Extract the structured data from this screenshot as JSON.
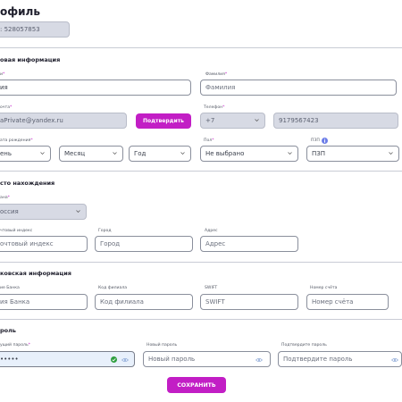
{
  "page": {
    "title": "офиль",
    "id_field": ": 528057853"
  },
  "basic": {
    "heading": "овая информация",
    "first_name": {
      "label": "и",
      "value": "ия"
    },
    "last_name": {
      "label": "Фамилия",
      "placeholder": "Фамилия"
    },
    "email": {
      "label": "очта",
      "value": "aPrivate@yandex.ru"
    },
    "confirm_button": "Подтвердить",
    "phone": {
      "label": "Телефон",
      "code": "+7",
      "number": "9179567423"
    },
    "birth": {
      "label": "ата рождения",
      "day": "ень",
      "month": "Месяц",
      "year": "Год"
    },
    "gender": {
      "label": "Пол",
      "value": "Не выбрано"
    },
    "pzp": {
      "label": "ПЗП",
      "value": "ПЗП"
    }
  },
  "location": {
    "heading": "сто нахождения",
    "country": {
      "label": "ана",
      "value": "оссия"
    },
    "postal": {
      "label": "чтовый индекс",
      "placeholder": "очтовый индекс"
    },
    "city": {
      "label": "Город",
      "placeholder": "Город"
    },
    "address": {
      "label": "Адрес",
      "placeholder": "Адрес"
    }
  },
  "bank": {
    "heading": "ковская информация",
    "bank_name": {
      "label": "ие Банка",
      "placeholder": "ия Банка"
    },
    "branch": {
      "label": "Код филиала",
      "placeholder": "Код филиала"
    },
    "swift": {
      "label": "SWIFT",
      "placeholder": "SWIFT"
    },
    "account": {
      "label": "Номер счёта",
      "placeholder": "Номер счёта"
    }
  },
  "password": {
    "heading": "роль",
    "current": {
      "label": "ущий пароль",
      "value": "•••••"
    },
    "new": {
      "label": "Новый пароль",
      "placeholder": "Новый пароль"
    },
    "confirm": {
      "label": "Подтвердите пароль",
      "placeholder": "Подтвердите пароль"
    }
  },
  "save_button": "СОХРАНИТЬ",
  "colors": {
    "accent": "#c21ec5",
    "valid": "#2e9e3e",
    "disabled_bg": "#d7dae4",
    "info": "#6d7ee8"
  }
}
